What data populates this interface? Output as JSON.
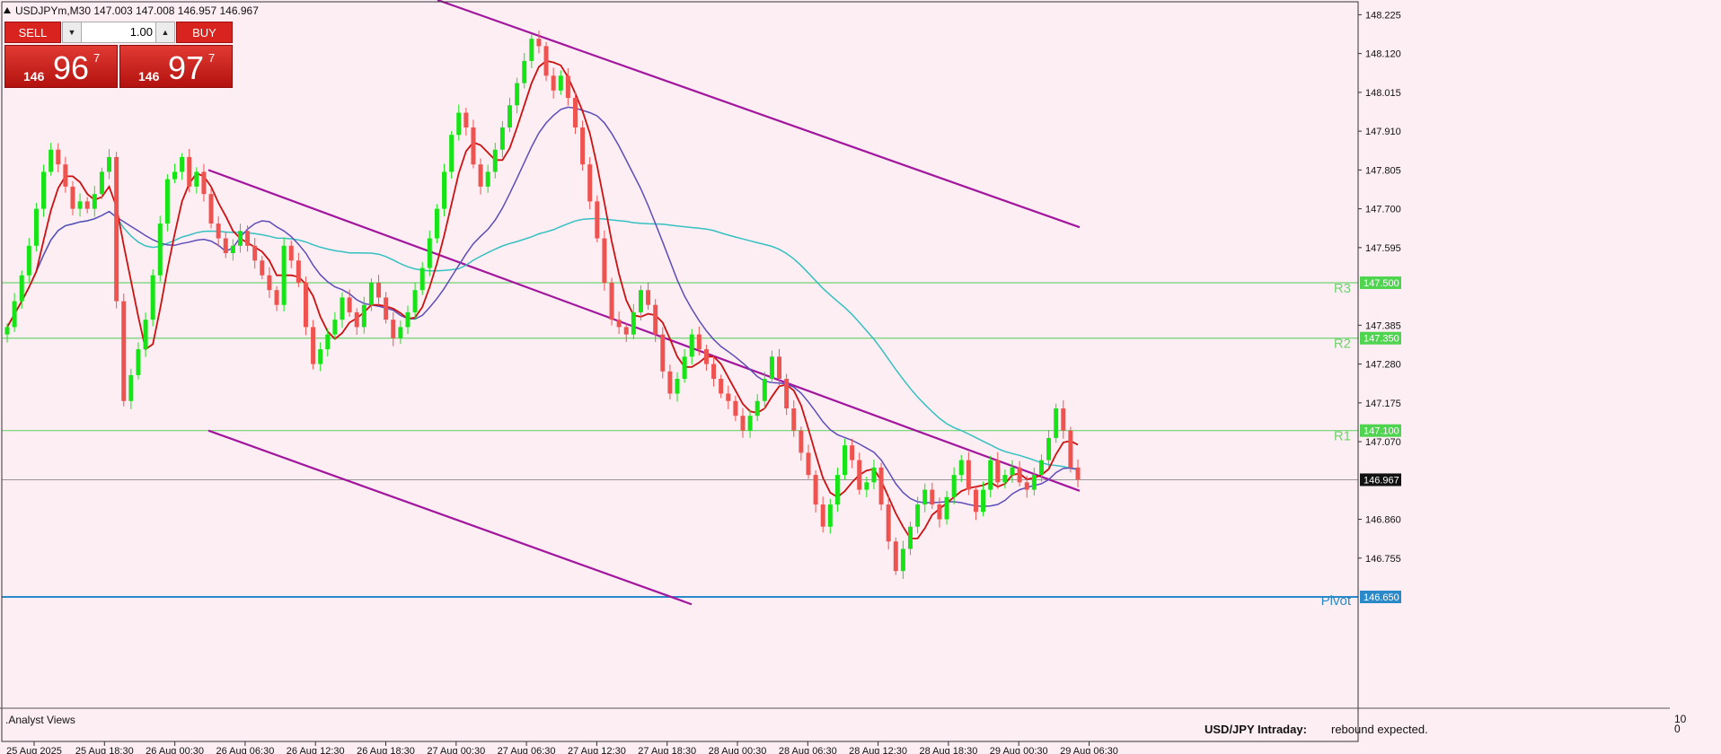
{
  "header": {
    "title": "USDJPYm,M30  147.003 147.008 146.957 146.967"
  },
  "trade_panel": {
    "sell_label": "SELL",
    "buy_label": "BUY",
    "lot": "1.00",
    "sell_small": "146",
    "sell_big": "96",
    "sell_sup": "7",
    "buy_small": "146",
    "buy_big": "97",
    "buy_sup": "7"
  },
  "indicator_pane": {
    "label": ".Analyst Views",
    "scale_max": "10",
    "scale_min": "0"
  },
  "annotation": {
    "bold": "USD/JPY Intraday:",
    "text": "rebound expected."
  },
  "colors": {
    "background": "#fdeef4",
    "bull": "#17e417",
    "bear": "#ef5350",
    "level_line": "#6fd36f",
    "level_label_bg": "#4fd44f",
    "pivot_line": "#2a89c9",
    "channel": "#a2169d",
    "ma_fast": "#cc1111",
    "ma_mid": "#5c4db8",
    "ma_slow": "#35c0c0"
  },
  "chart_data": {
    "type": "candlestick",
    "symbol": "USDJPYm",
    "timeframe": "M30",
    "ylim": [
      146.65,
      148.26
    ],
    "y_ticks": [
      "148.225",
      "148.120",
      "148.015",
      "147.910",
      "147.805",
      "147.700",
      "147.595",
      "147.385",
      "147.280",
      "147.175",
      "147.070",
      "146.860",
      "146.755"
    ],
    "x_ticks": [
      "25 Aug 2025",
      "25 Aug 18:30",
      "26 Aug 00:30",
      "26 Aug 06:30",
      "26 Aug 12:30",
      "26 Aug 18:30",
      "27 Aug 00:30",
      "27 Aug 06:30",
      "27 Aug 12:30",
      "27 Aug 18:30",
      "28 Aug 00:30",
      "28 Aug 06:30",
      "28 Aug 12:30",
      "28 Aug 18:30",
      "29 Aug 00:30",
      "29 Aug 06:30"
    ],
    "levels": [
      {
        "name": "R3",
        "value": "147.500"
      },
      {
        "name": "R2",
        "value": "147.350"
      },
      {
        "name": "R1",
        "value": "147.100"
      },
      {
        "name": "Pivot",
        "value": "146.650"
      }
    ],
    "current_price": "146.967",
    "closes": [
      147.38,
      147.45,
      147.52,
      147.6,
      147.7,
      147.8,
      147.86,
      147.82,
      147.76,
      147.7,
      147.72,
      147.7,
      147.74,
      147.8,
      147.84,
      147.45,
      147.18,
      147.25,
      147.32,
      147.4,
      147.52,
      147.66,
      147.78,
      147.8,
      147.84,
      147.76,
      147.8,
      147.74,
      147.66,
      147.62,
      147.58,
      147.6,
      147.64,
      147.6,
      147.56,
      147.52,
      147.48,
      147.44,
      147.6,
      147.56,
      147.5,
      147.38,
      147.28,
      147.32,
      147.36,
      147.4,
      147.46,
      147.42,
      147.38,
      147.44,
      147.5,
      147.46,
      147.4,
      147.35,
      147.38,
      147.42,
      147.48,
      147.54,
      147.62,
      147.7,
      147.8,
      147.9,
      147.96,
      147.92,
      147.82,
      147.76,
      147.8,
      147.86,
      147.92,
      147.98,
      148.04,
      148.1,
      148.16,
      148.14,
      148.06,
      148.02,
      148.06,
      148.0,
      147.92,
      147.82,
      147.72,
      147.62,
      147.5,
      147.4,
      147.38,
      147.36,
      147.42,
      147.48,
      147.44,
      147.36,
      147.26,
      147.2,
      147.24,
      147.3,
      147.36,
      147.32,
      147.28,
      147.24,
      147.2,
      147.18,
      147.14,
      147.1,
      147.14,
      147.18,
      147.24,
      147.3,
      147.24,
      147.16,
      147.1,
      147.04,
      146.98,
      146.9,
      146.84,
      146.9,
      146.98,
      147.06,
      147.02,
      146.94,
      146.96,
      147.0,
      146.9,
      146.8,
      146.72,
      146.78,
      146.84,
      146.9,
      146.94,
      146.9,
      146.86,
      146.92,
      146.98,
      147.02,
      146.94,
      146.88,
      146.94,
      147.02,
      146.96,
      146.98,
      147.0,
      146.96,
      146.94,
      146.98,
      147.02,
      147.08,
      147.16,
      147.1,
      147.0,
      146.967
    ]
  }
}
